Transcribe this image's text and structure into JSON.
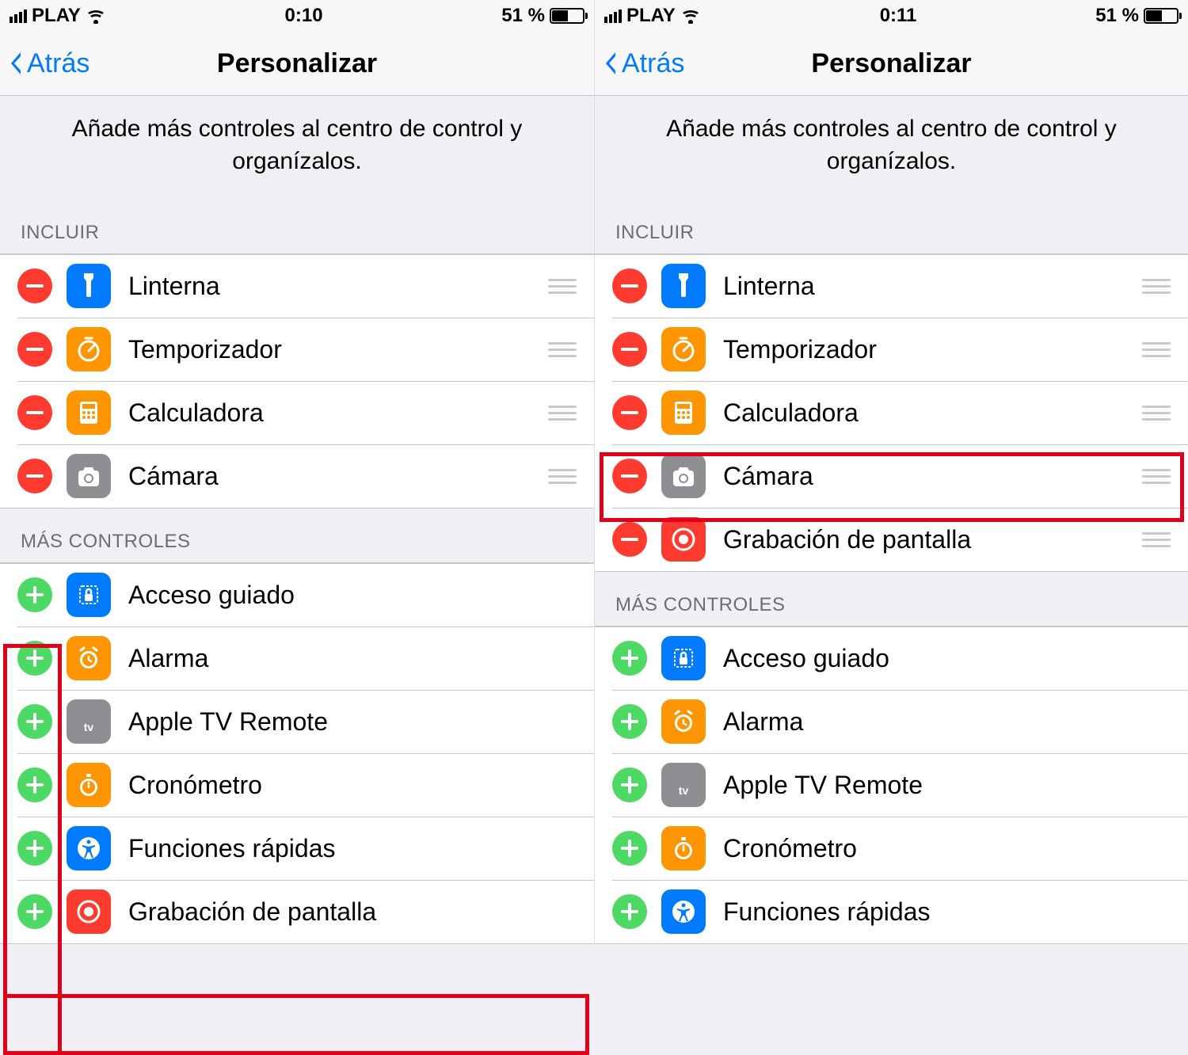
{
  "left": {
    "status": {
      "carrier": "PLAY",
      "time": "0:10",
      "battery": "51 %"
    },
    "nav": {
      "back": "Atrás",
      "title": "Personalizar"
    },
    "desc": "Añade más controles al centro de control y organízalos.",
    "sect_include": "INCLUIR",
    "include": [
      {
        "label": "Linterna",
        "icon": "flashlight",
        "color": "blue"
      },
      {
        "label": "Temporizador",
        "icon": "timer",
        "color": "orange"
      },
      {
        "label": "Calculadora",
        "icon": "calculator",
        "color": "orange"
      },
      {
        "label": "Cámara",
        "icon": "camera",
        "color": "gray"
      }
    ],
    "sect_more": "MÁS CONTROLES",
    "more": [
      {
        "label": "Acceso guiado",
        "icon": "lock",
        "color": "blue"
      },
      {
        "label": "Alarma",
        "icon": "alarm",
        "color": "orange"
      },
      {
        "label": "Apple TV Remote",
        "icon": "appletv",
        "color": "gray"
      },
      {
        "label": "Cronómetro",
        "icon": "stopwatch",
        "color": "orange"
      },
      {
        "label": "Funciones rápidas",
        "icon": "accessibility",
        "color": "blue"
      },
      {
        "label": "Grabación de pantalla",
        "icon": "record",
        "color": "red"
      }
    ]
  },
  "right": {
    "status": {
      "carrier": "PLAY",
      "time": "0:11",
      "battery": "51 %"
    },
    "nav": {
      "back": "Atrás",
      "title": "Personalizar"
    },
    "desc": "Añade más controles al centro de control y organízalos.",
    "sect_include": "INCLUIR",
    "include": [
      {
        "label": "Linterna",
        "icon": "flashlight",
        "color": "blue"
      },
      {
        "label": "Temporizador",
        "icon": "timer",
        "color": "orange"
      },
      {
        "label": "Calculadora",
        "icon": "calculator",
        "color": "orange"
      },
      {
        "label": "Cámara",
        "icon": "camera",
        "color": "gray"
      },
      {
        "label": "Grabación de pantalla",
        "icon": "record",
        "color": "red"
      }
    ],
    "sect_more": "MÁS CONTROLES",
    "more": [
      {
        "label": "Acceso guiado",
        "icon": "lock",
        "color": "blue"
      },
      {
        "label": "Alarma",
        "icon": "alarm",
        "color": "orange"
      },
      {
        "label": "Apple TV Remote",
        "icon": "appletv",
        "color": "gray"
      },
      {
        "label": "Cronómetro",
        "icon": "stopwatch",
        "color": "orange"
      },
      {
        "label": "Funciones rápidas",
        "icon": "accessibility",
        "color": "blue"
      }
    ]
  }
}
